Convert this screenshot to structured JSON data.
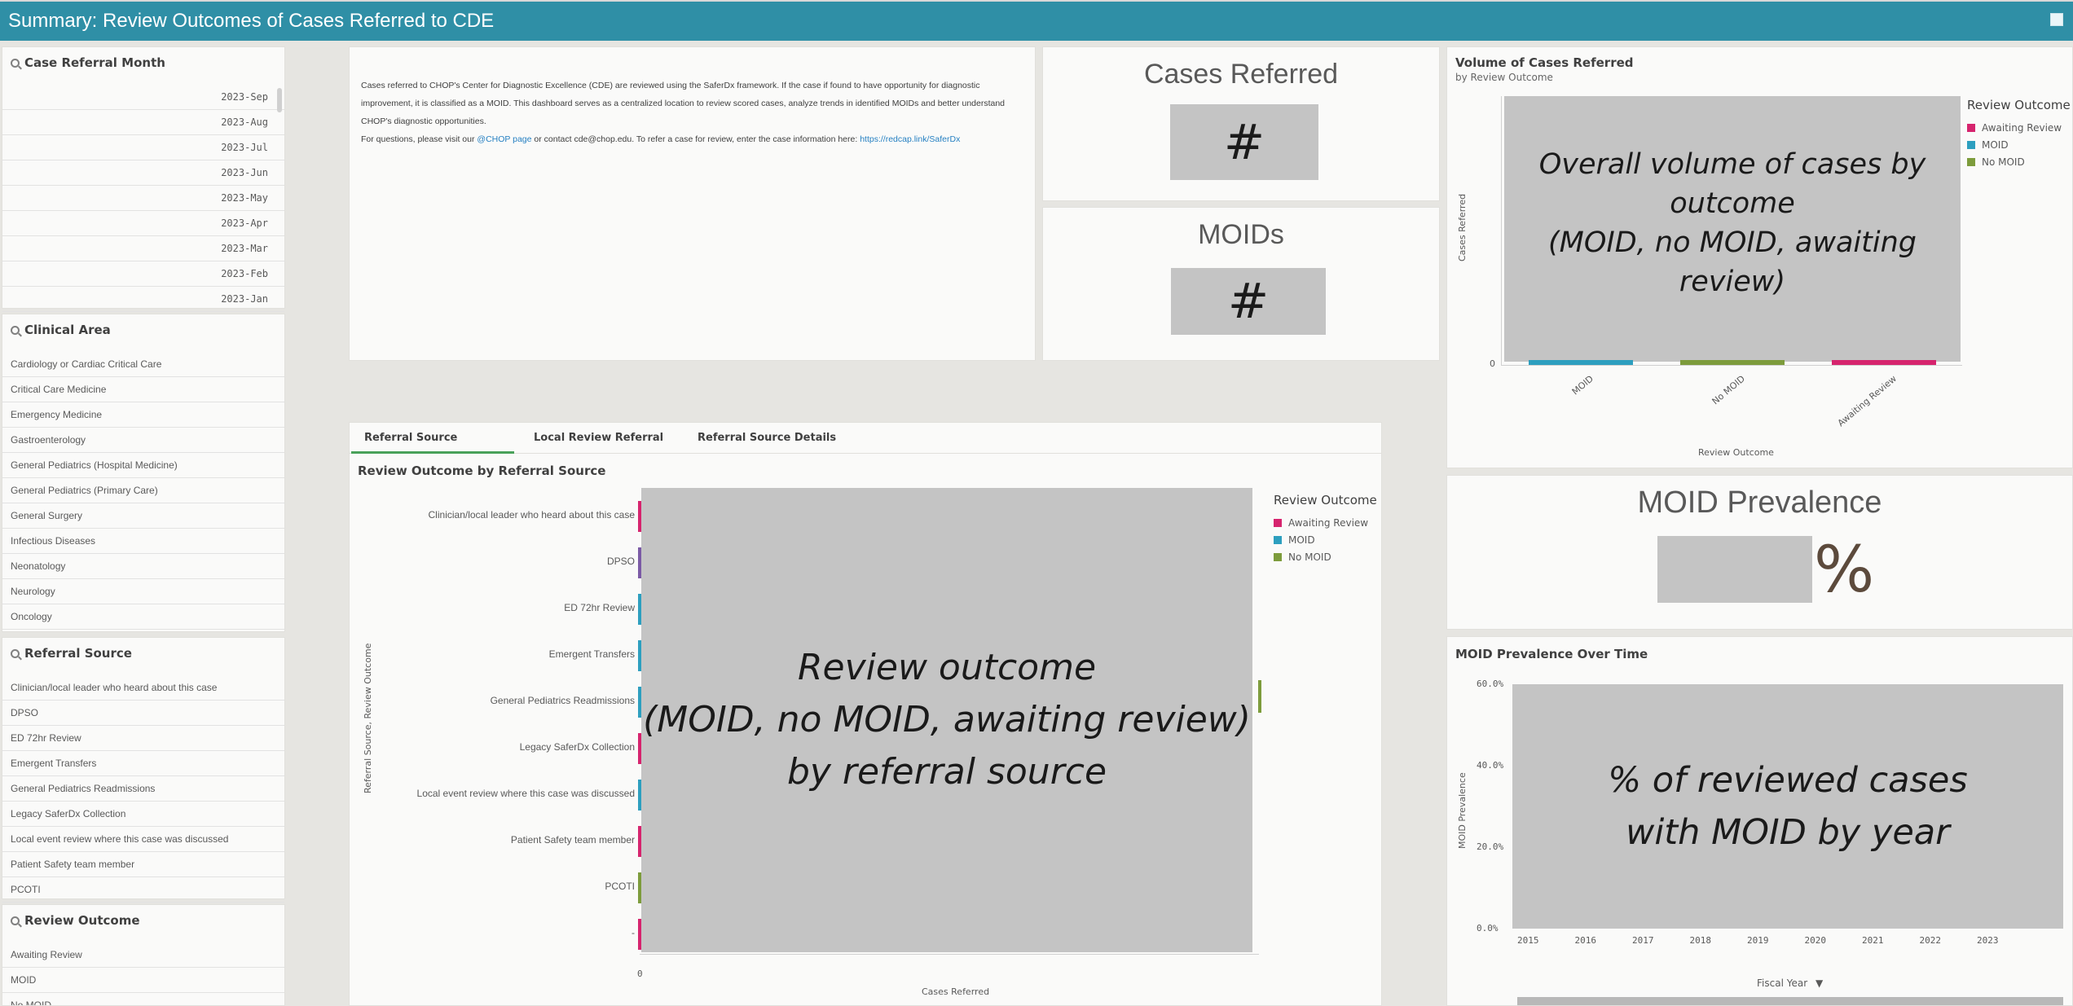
{
  "app": {
    "title": "Summary: Review Outcomes of Cases Referred to CDE"
  },
  "colors": {
    "awaiting": "#d6246e",
    "moid": "#2d9fbf",
    "nomoid": "#7d9c3c",
    "accent": "#49a15a",
    "header": "#2f8fa6"
  },
  "filters": {
    "month": {
      "title": "Case Referral Month",
      "items": [
        "2023-Sep",
        "2023-Aug",
        "2023-Jul",
        "2023-Jun",
        "2023-May",
        "2023-Apr",
        "2023-Mar",
        "2023-Feb",
        "2023-Jan"
      ]
    },
    "clinical": {
      "title": "Clinical Area",
      "items": [
        "Cardiology or Cardiac Critical Care",
        "Critical Care Medicine",
        "Emergency Medicine",
        "Gastroenterology",
        "General Pediatrics (Hospital Medicine)",
        "General Pediatrics (Primary Care)",
        "General Surgery",
        "Infectious Diseases",
        "Neonatology",
        "Neurology",
        "Oncology"
      ]
    },
    "source": {
      "title": "Referral Source",
      "items": [
        "Clinician/local leader who heard about this case",
        "DPSO",
        "ED 72hr Review",
        "Emergent Transfers",
        "General Pediatrics Readmissions",
        "Legacy SaferDx Collection",
        "Local event review where this case was discussed",
        "Patient Safety team member",
        "PCOTI"
      ]
    },
    "outcome": {
      "title": "Review Outcome",
      "items": [
        "Awaiting Review",
        "MOID",
        "No MOID"
      ]
    }
  },
  "description": {
    "p1": "Cases referred to CHOP's Center for Diagnostic Excellence (CDE) are reviewed using the SaferDx framework. If the case if found to have opportunity for diagnostic improvement, it is classified as a MOID. This dashboard serves as a centralized location to review scored cases, analyze trends in identified MOIDs and better understand CHOP's diagnostic opportunities.",
    "p2a": "For questions, please visit our ",
    "link1": "@CHOP page",
    "p2b": " or contact cde@chop.edu. To refer a case for review, enter the case information here: ",
    "link2": "https://redcap.link/SaferDx"
  },
  "kpis": {
    "cases": {
      "title": "Cases Referred",
      "value": "#"
    },
    "moids": {
      "title": "MOIDs",
      "value": "#"
    },
    "prevalence": {
      "title": "MOID Prevalence",
      "value": "%"
    }
  },
  "volume_chart": {
    "title": "Volume of Cases Referred",
    "subtitle": "by Review Outcome",
    "placeholder_l1": "Overall volume of cases by",
    "placeholder_l2": "outcome",
    "placeholder_l3": "(MOID, no MOID, awaiting review)",
    "ylabel": "Cases Referred",
    "xlabel": "Review Outcome",
    "y_zero": "0",
    "legend_title": "Review Outcome"
  },
  "tabs": [
    "Referral Source",
    "Local Review Referral",
    "Referral Source Details"
  ],
  "source_chart": {
    "title": "Review Outcome by Referral Source",
    "placeholder_l1": "Review outcome",
    "placeholder_l2": "(MOID, no MOID, awaiting review)",
    "placeholder_l3": "by referral source",
    "ylabel": "Referral Source, Review Outcome",
    "xlabel": "Cases Referred",
    "x_zero": "0",
    "legend_title": "Review Outcome",
    "dash_label": "-"
  },
  "prevalence_chart": {
    "title": "MOID Prevalence Over Time",
    "placeholder_l1": "% of reviewed cases",
    "placeholder_l2": "with MOID by year",
    "ylabel": "MOID Prevalence",
    "xlabel": "Fiscal Year",
    "dropdown_icon": "caret-down-icon"
  },
  "chart_data": [
    {
      "type": "bar",
      "title": "Volume of Cases Referred",
      "subtitle": "by Review Outcome",
      "categories": [
        "MOID",
        "No MOID",
        "Awaiting Review"
      ],
      "series": [
        {
          "name": "MOID",
          "values": [
            0,
            null,
            null
          ]
        },
        {
          "name": "No MOID",
          "values": [
            null,
            0,
            null
          ]
        },
        {
          "name": "Awaiting Review",
          "values": [
            null,
            null,
            0
          ]
        }
      ],
      "xlabel": "Review Outcome",
      "ylabel": "Cases Referred",
      "ylim": [
        0,
        null
      ],
      "legend": "right"
    },
    {
      "type": "bar",
      "title": "Review Outcome by Referral Source",
      "orientation": "horizontal",
      "categories": [
        "Clinician/local leader who heard about this case",
        "DPSO",
        "ED 72hr Review",
        "Emergent Transfers",
        "General Pediatrics Readmissions",
        "Legacy SaferDx Collection",
        "Local event review where this case was discussed",
        "Patient Safety team member",
        "PCOTI",
        "-"
      ],
      "series": [
        {
          "name": "Awaiting Review"
        },
        {
          "name": "MOID"
        },
        {
          "name": "No MOID"
        }
      ],
      "bar_colors": [
        "#d6246e",
        "#7b5aa6",
        "#2d9fbf",
        "#2d9fbf",
        "#2d9fbf",
        "#d6246e",
        "#2d9fbf",
        "#d6246e",
        "#7d9c3c",
        "#d6246e"
      ],
      "xlabel": "Cases Referred",
      "ylabel": "Referral Source, Review Outcome",
      "legend": "right"
    },
    {
      "type": "line",
      "title": "MOID Prevalence Over Time",
      "x": [
        "2015",
        "2016",
        "2017",
        "2018",
        "2019",
        "2020",
        "2021",
        "2022",
        "2023"
      ],
      "ylabel": "MOID Prevalence",
      "xlabel": "Fiscal Year",
      "yticks": [
        "0.0%",
        "20.0%",
        "40.0%",
        "60.0%"
      ],
      "ylim": [
        0,
        60
      ]
    }
  ]
}
